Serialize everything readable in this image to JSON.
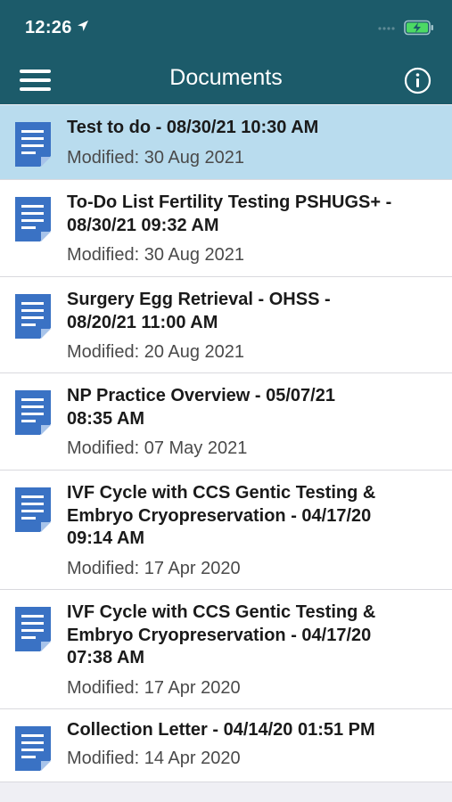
{
  "status_bar": {
    "time": "12:26",
    "icons": [
      "location-arrow-icon",
      "signal-dots-icon",
      "battery-charging-icon"
    ]
  },
  "header": {
    "title": "Documents",
    "left_icon": "hamburger-menu-icon",
    "right_icon": "info-icon"
  },
  "colors": {
    "header": "#1c5b6a",
    "selected_row": "#b9dcee",
    "doc_icon": "#3a72c4",
    "battery": "#4cd964"
  },
  "documents": [
    {
      "title": "Test to do - 08/30/21 10:30 AM",
      "modified": "Modified: 30 Aug 2021",
      "selected": true
    },
    {
      "title_lines": [
        "To-Do List Fertility Testing PSHUGS+ -",
        "08/30/21 09:32 AM"
      ],
      "modified": "Modified: 30 Aug 2021"
    },
    {
      "title_lines": [
        "Surgery Egg Retrieval - OHSS -",
        "08/20/21 11:00 AM"
      ],
      "modified": "Modified: 20 Aug 2021"
    },
    {
      "title_lines": [
        "NP Practice Overview - 05/07/21",
        "08:35 AM"
      ],
      "modified": "Modified: 07 May 2021"
    },
    {
      "title_lines": [
        "IVF Cycle with CCS Gentic Testing &",
        "Embryo Cryopreservation - 04/17/20",
        "09:14 AM"
      ],
      "modified": "Modified: 17 Apr 2020"
    },
    {
      "title_lines": [
        "IVF Cycle with CCS Gentic Testing &",
        "Embryo Cryopreservation - 04/17/20",
        "07:38 AM"
      ],
      "modified": "Modified: 17 Apr 2020"
    },
    {
      "title": "Collection Letter - 04/14/20 01:51 PM",
      "modified": "Modified: 14 Apr 2020"
    }
  ]
}
